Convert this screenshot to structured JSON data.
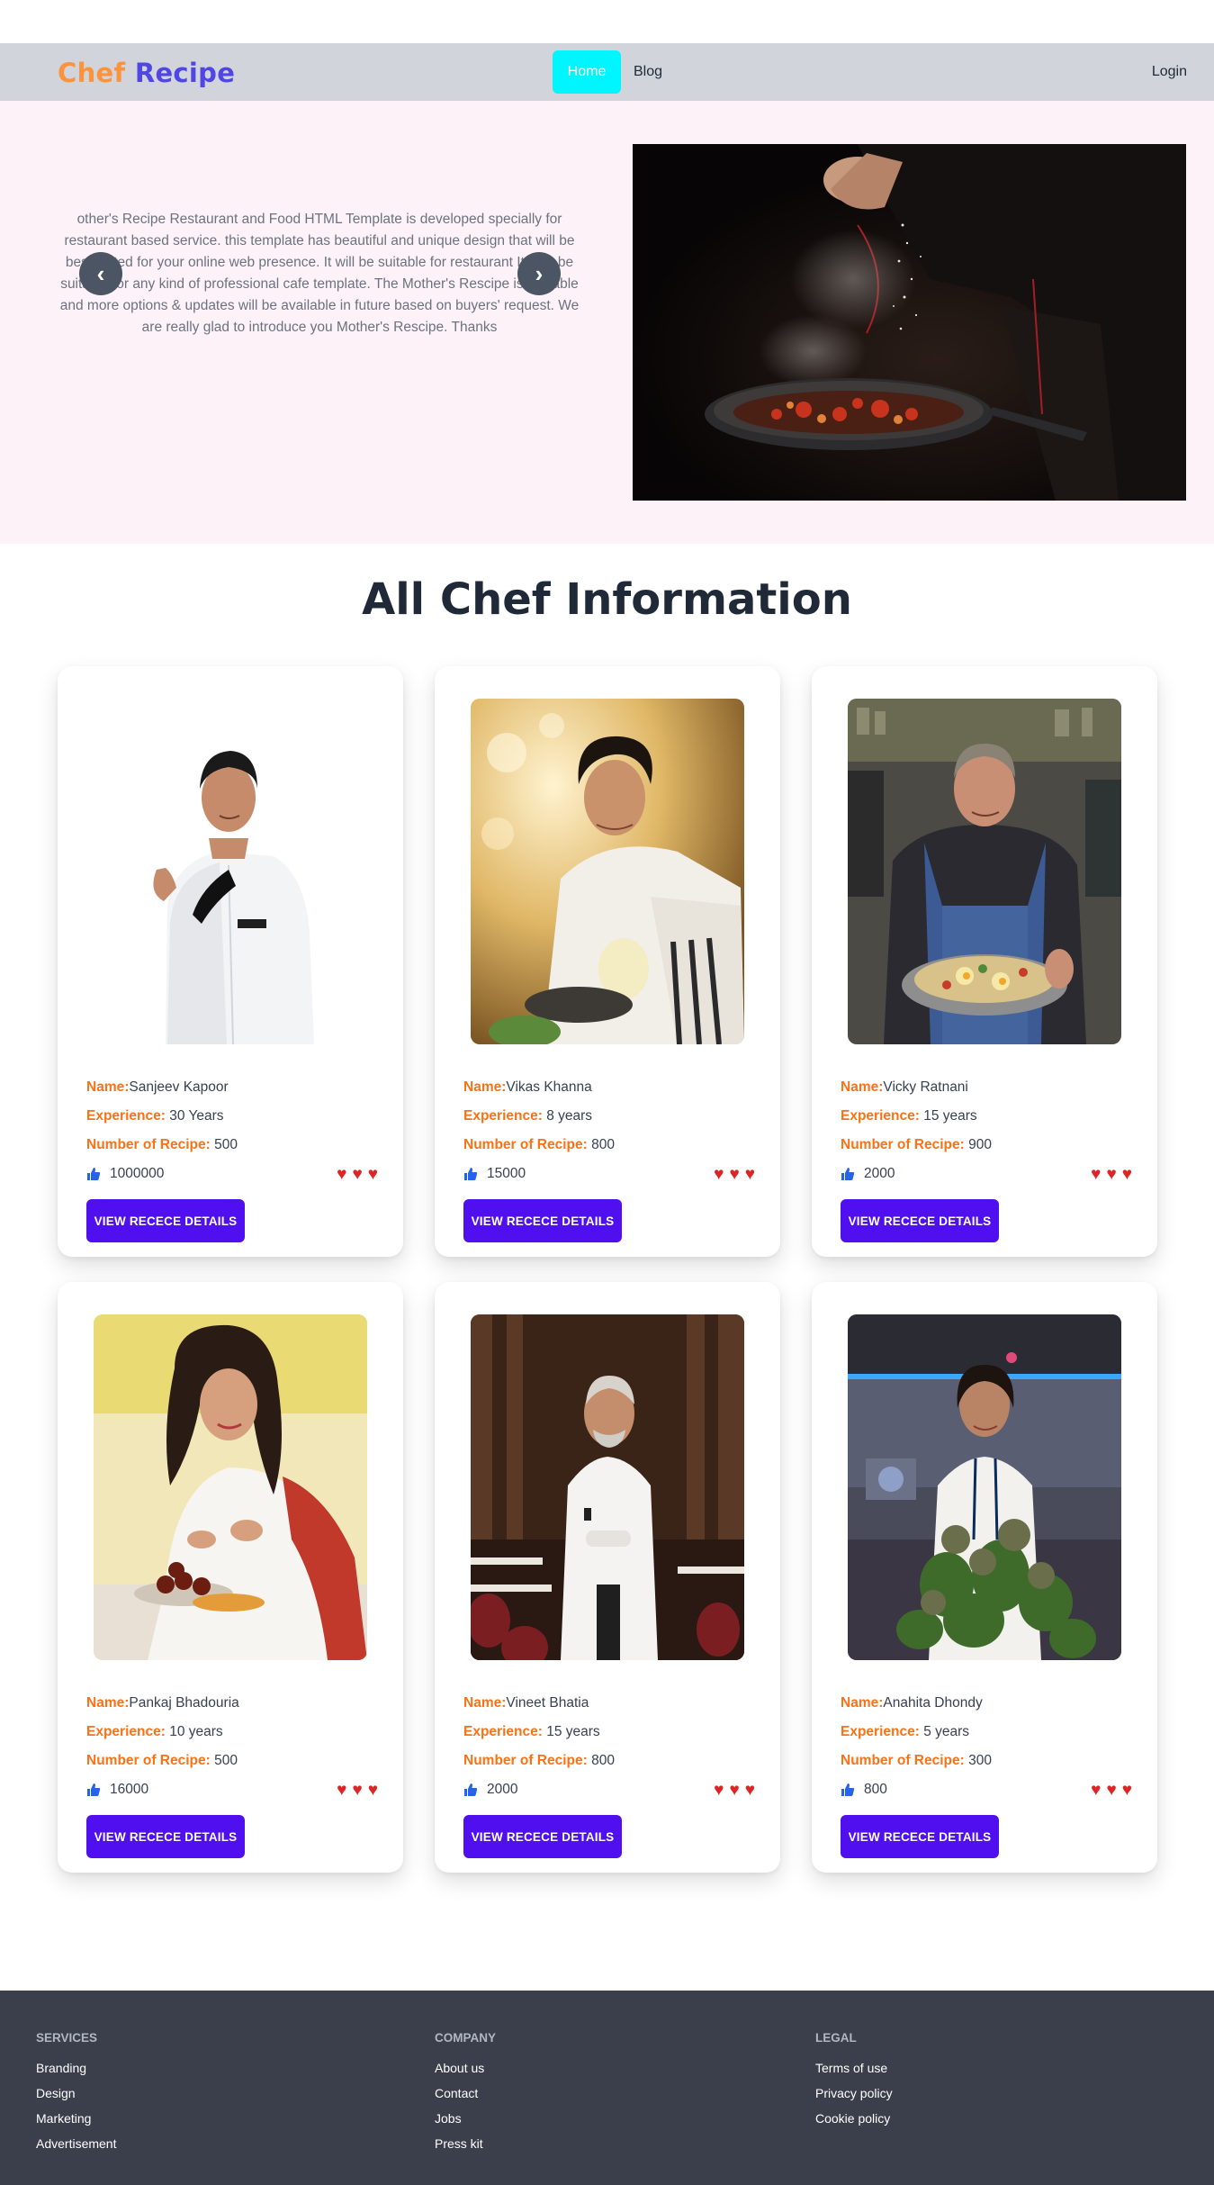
{
  "navbar": {
    "logo_part1": "Chef",
    "logo_part2": "Recipe",
    "home": "Home",
    "blog": "Blog",
    "login": "Login"
  },
  "hero": {
    "text": "other's Recipe Restaurant and Food HTML Template is developed specially for restaurant based service. this template has beautiful and unique design that will be best suited for your online web presence. It will be suitable for restaurant It also be suitable for any kind of professional cafe template. The Mother's Rescipe is scalable and more options & updates will be available in future based on buyers' request. We are really glad to introduce you Mother's Rescipe. Thanks",
    "prev": "‹",
    "next": "›"
  },
  "section_title": "All Chef Information",
  "labels": {
    "name": "Name:",
    "experience": "Experience:",
    "recipes": "Number of Recipe:",
    "button": "VIEW RECECE DETAILS"
  },
  "chefs": [
    {
      "name": "Sanjeev Kapoor",
      "experience": "30 Years",
      "recipes": "500",
      "likes": "1000000"
    },
    {
      "name": "Vikas Khanna",
      "experience": "8 years",
      "recipes": "800",
      "likes": "15000"
    },
    {
      "name": "Vicky Ratnani",
      "experience": "15 years",
      "recipes": "900",
      "likes": "2000"
    },
    {
      "name": "Pankaj Bhadouria",
      "experience": "10 years",
      "recipes": "500",
      "likes": "16000"
    },
    {
      "name": "Vineet Bhatia",
      "experience": "15 years",
      "recipes": "800",
      "likes": "2000"
    },
    {
      "name": "Anahita Dhondy",
      "experience": "5 years",
      "recipes": "300",
      "likes": "800"
    }
  ],
  "footer": {
    "services": {
      "title": "SERVICES",
      "links": [
        "Branding",
        "Design",
        "Marketing",
        "Advertisement"
      ]
    },
    "company": {
      "title": "COMPANY",
      "links": [
        "About us",
        "Contact",
        "Jobs",
        "Press kit"
      ]
    },
    "legal": {
      "title": "LEGAL",
      "links": [
        "Terms of use",
        "Privacy policy",
        "Cookie policy"
      ]
    }
  },
  "colors": {
    "accent": "#4f0fef",
    "label": "#f97316",
    "heart": "#dc2626",
    "nav_active": "#00f5ff",
    "footer_bg": "#3a3f4b"
  },
  "icons": [
    "thumbs-up-icon",
    "heart-icon",
    "chevron-left-icon",
    "chevron-right-icon"
  ]
}
